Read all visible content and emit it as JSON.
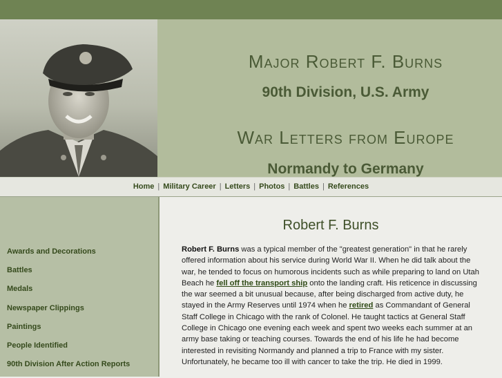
{
  "banner": {
    "name": "Major Robert F. Burns",
    "division": "90th Division, U.S. Army",
    "war_letters": "War Letters from Europe",
    "route": "Normandy to Germany"
  },
  "nav": {
    "items": [
      "Home",
      "Military Career",
      "Letters",
      "Photos",
      "Battles",
      "References"
    ],
    "separator": "|"
  },
  "sidebar": {
    "items": [
      "Awards and Decorations",
      "Battles",
      "Medals",
      "Newspaper Clippings",
      "Paintings",
      "People Identified",
      "90th Division After Action Reports"
    ]
  },
  "article": {
    "heading": "Robert F. Burns",
    "lead_name": "Robert F. Burns",
    "text_1": " was a typical member of the \"greatest generation\" in that he rarely offered information about his service during World War II. When he did talk about the war, he tended to focus on humorous incidents such as while preparing to land on Utah Beach he ",
    "link_1": "fell off the transport ship",
    "text_2": " onto the landing craft. His reticence in discussing the war seemed a bit unusual because, after being discharged from active duty, he stayed in the Army Reserves until 1974 when he ",
    "link_2": "retired",
    "text_3": " as Commandant of General Staff College in Chicago with the rank of Colonel. He taught tactics at General Staff College in Chicago one evening each week and spent two weeks each summer at an army base taking or teaching courses. Towards the end of his life he had become interested in revisiting Normandy and planned a trip to France with my sister. Unfortunately, he became too ill with cancer to take the trip. He died in 1999."
  },
  "colors": {
    "top_bar": "#6f8353",
    "banner_bg": "#b2bc9c",
    "title_text": "#4a5a36",
    "sidebar_bg": "#b6bfa5",
    "link_text": "#354a1c"
  }
}
